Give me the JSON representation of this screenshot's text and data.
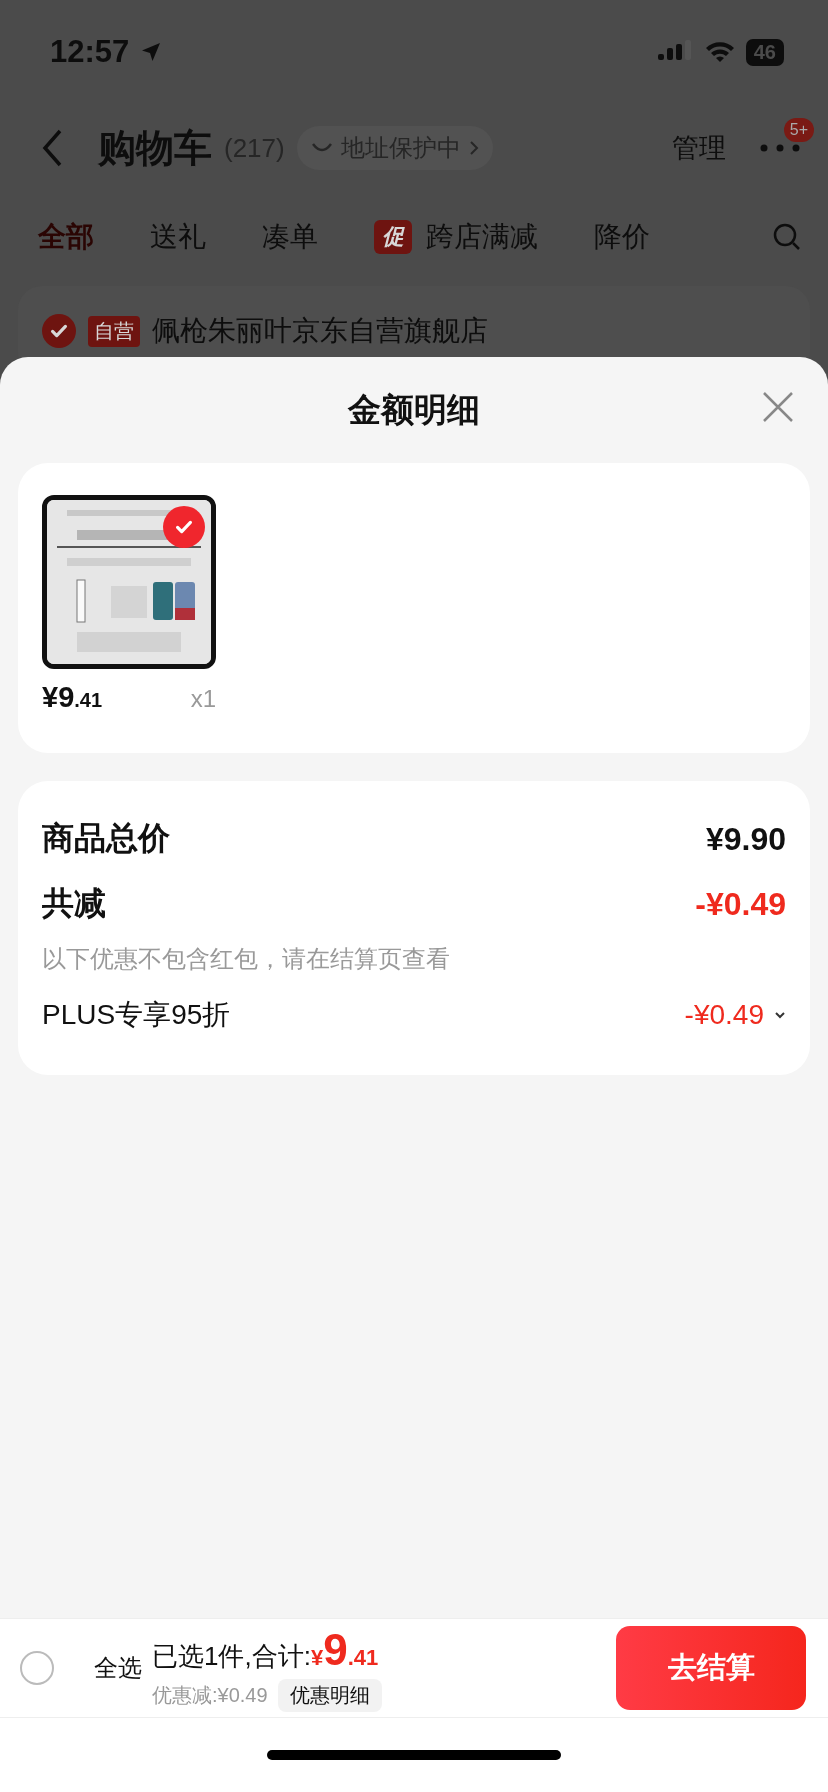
{
  "status_bar": {
    "time": "12:57",
    "battery": "46"
  },
  "nav": {
    "title": "购物车",
    "count": "(217)",
    "address_badge": "地址保护中",
    "manage": "管理",
    "notification_badge": "5+"
  },
  "tabs": [
    {
      "label": "全部",
      "selected": true
    },
    {
      "label": "送礼",
      "selected": false
    },
    {
      "label": "凑单",
      "selected": false
    },
    {
      "label": "跨店满减",
      "selected": false,
      "tag": "促"
    },
    {
      "label": "降价",
      "selected": false
    }
  ],
  "store": {
    "checked": true,
    "tag": "自营",
    "name": "佩枪朱丽叶京东自营旗舰店"
  },
  "sheet": {
    "title": "金额明细",
    "items": [
      {
        "checked": true,
        "price_main": "¥9",
        "price_decimal": ".41",
        "quantity": "x1"
      }
    ],
    "total": {
      "label": "商品总价",
      "value": "¥9.90"
    },
    "reduction": {
      "label": "共减",
      "value": "-¥0.49",
      "note": "以下优惠不包含红包，请在结算页查看"
    },
    "discounts": [
      {
        "label": "PLUS专享95折",
        "value": "-¥0.49"
      }
    ]
  },
  "bottom_bar": {
    "select_all": {
      "label": "全选",
      "checked": false
    },
    "summary": "已选1件,合计:",
    "currency": "¥",
    "total_main": "9",
    "total_decimal": ".41",
    "savings": "优惠减:¥0.49",
    "detail_button": "优惠明细",
    "checkout": "去结算"
  }
}
